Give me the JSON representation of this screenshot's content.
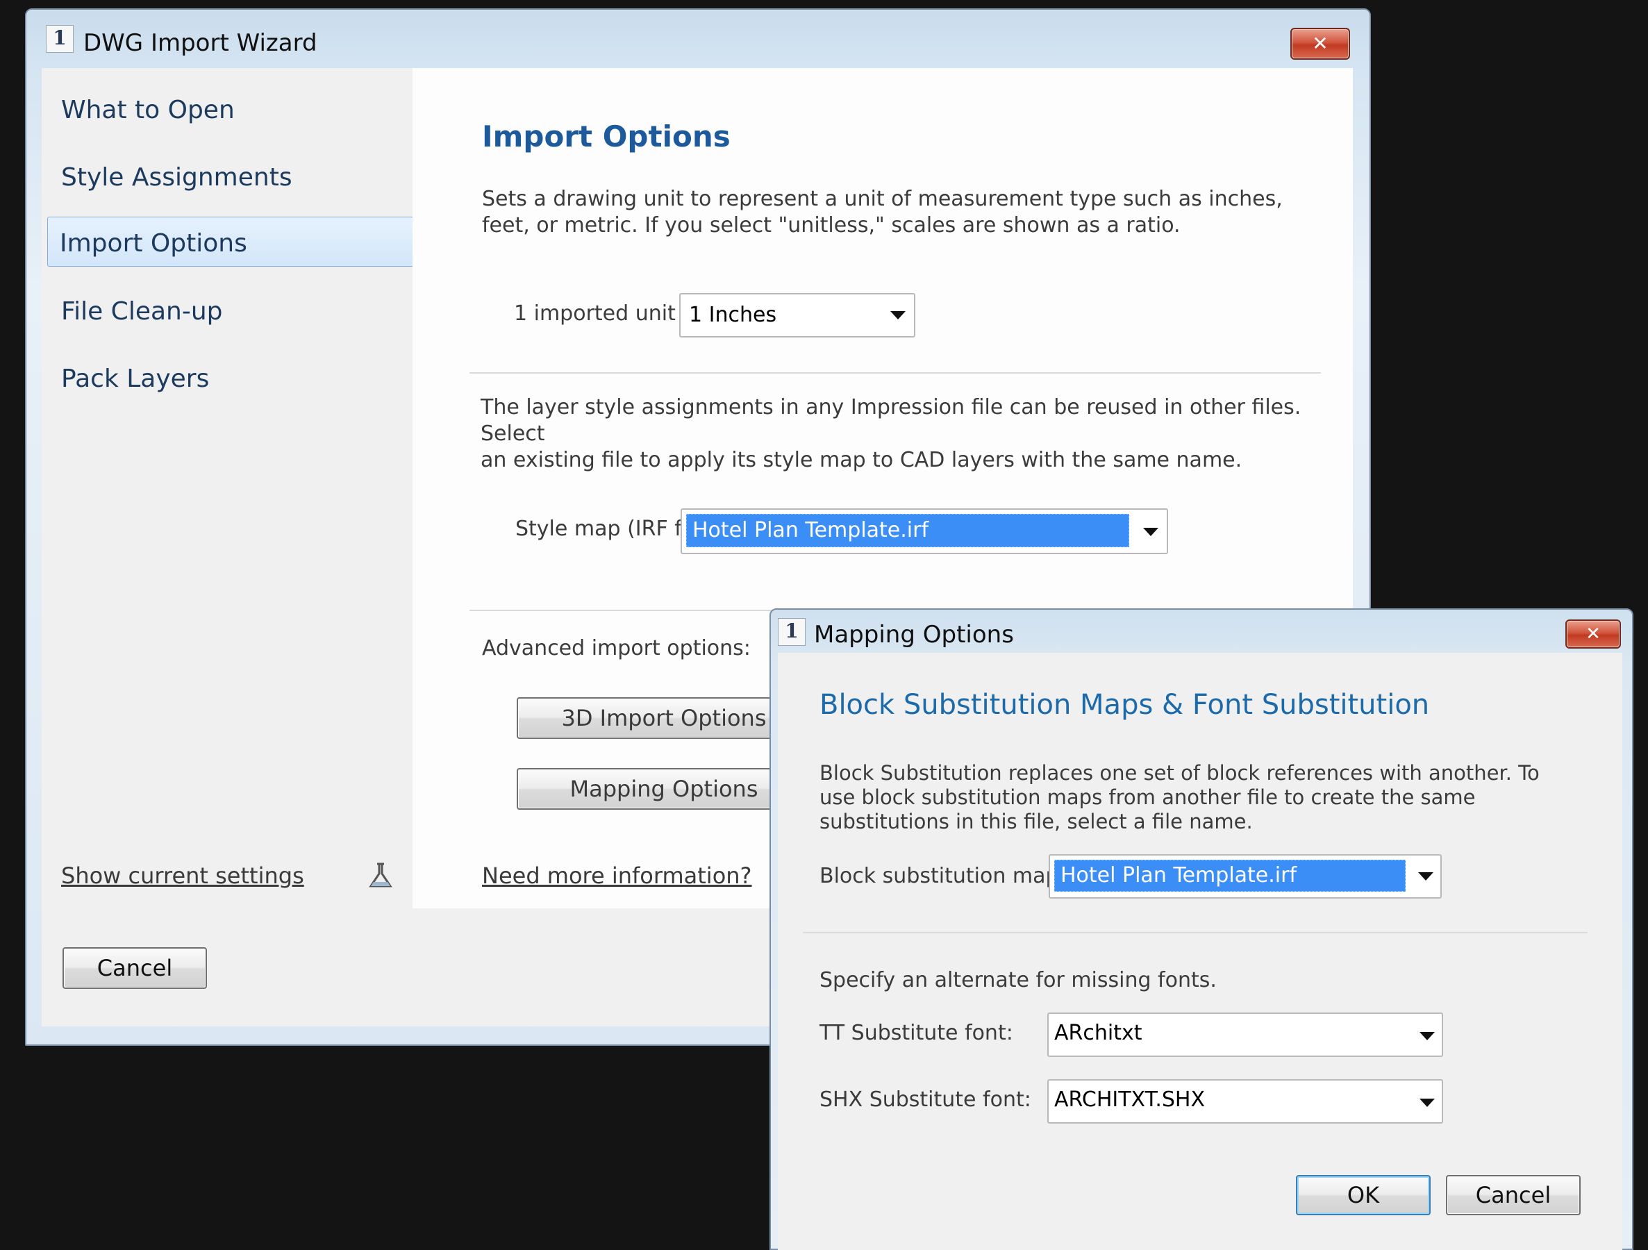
{
  "wizard": {
    "title": "DWG Import Wizard",
    "close_glyph": "✕",
    "nav": [
      "What to Open",
      "Style Assignments",
      "Import Options",
      "File Clean-up",
      "Pack Layers"
    ],
    "selected_nav": "Import Options",
    "show_settings_link": "Show current settings",
    "cancel_label": "Cancel",
    "content": {
      "heading": "Import Options",
      "desc1_line1": "Sets a drawing unit to represent a unit of measurement type such as inches,",
      "desc1_line2": "feet, or metric. If you select \"unitless,\" scales are shown as a ratio.",
      "unit_label": "1 imported unit =",
      "unit_value": "1 Inches",
      "desc2_line1": "The layer style assignments in any Impression file can be reused in other files. Select",
      "desc2_line2": "an existing file to apply its style map to CAD layers with the same name.",
      "style_map_label": "Style map (IRF file):",
      "style_map_value": "Hotel Plan Template.irf",
      "advanced_label": "Advanced import options:",
      "btn_3d": "3D Import Options",
      "btn_mapping": "Mapping Options",
      "more_info_link": "Need more information?"
    }
  },
  "mapping_dialog": {
    "title": "Mapping Options",
    "close_glyph": "✕",
    "heading": "Block Substitution Maps & Font Substitution",
    "desc_line1": "Block Substitution replaces one set of block references with another. To",
    "desc_line2": "use block substitution maps from another file to create the same",
    "desc_line3": "substitutions in this file, select a file name.",
    "block_map_label": "Block substitution map:",
    "block_map_value": "Hotel Plan Template.irf",
    "fonts_desc": "Specify an alternate for missing fonts.",
    "tt_label": "TT Substitute font:",
    "tt_value": "ARchitxt",
    "shx_label": "SHX Substitute font:",
    "shx_value": "ARCHITXT.SHX",
    "ok_label": "OK",
    "cancel_label": "Cancel"
  },
  "colors": {
    "heading": "#1d5a9c",
    "selection": "#3a8ef6",
    "close_button": "#c94a32"
  },
  "icons": [
    "app-icon",
    "close-icon",
    "chevron-down-icon",
    "settings-flask-icon"
  ]
}
